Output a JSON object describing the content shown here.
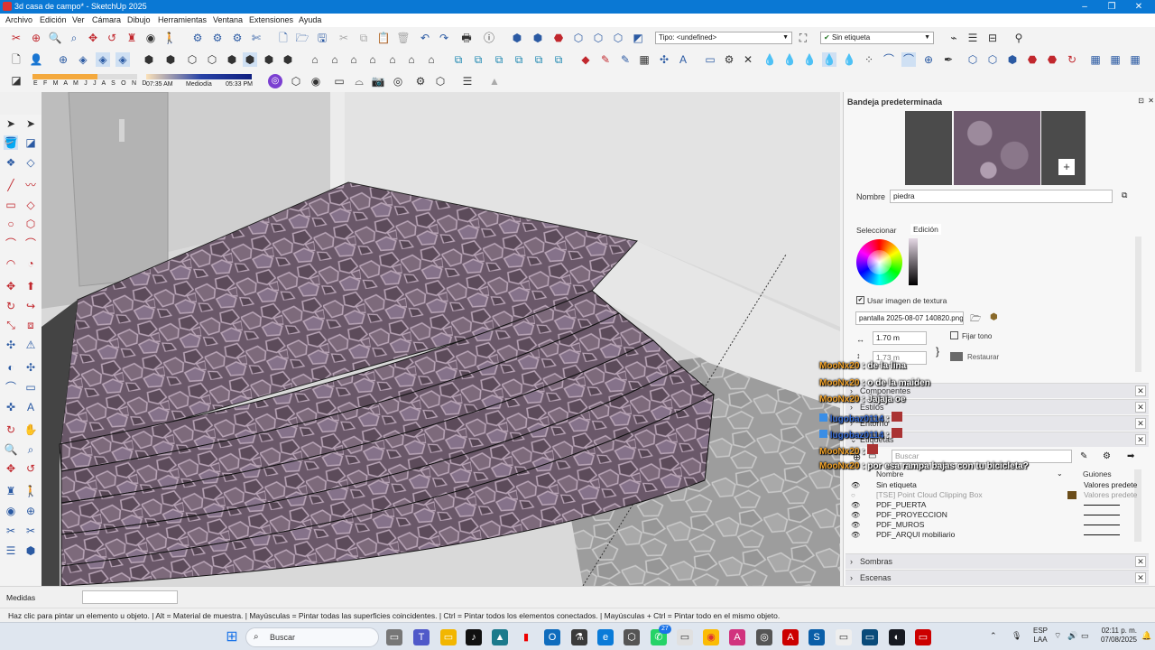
{
  "window": {
    "title": "3d casa de campo* - SketchUp 2025"
  },
  "menu": [
    "Archivo",
    "Edición",
    "Ver",
    "Cámara",
    "Dibujo",
    "Herramientas",
    "Ventana",
    "Extensiones",
    "Ayuda"
  ],
  "toolbar": {
    "type_select": "Tipo: <undefined>",
    "tag_select": "Sin etiqueta",
    "shadow_months": "E F M A M J J A S O N D",
    "time_start": "07:35 AM",
    "time_mid": "Mediodía",
    "time_end": "05:33 PM"
  },
  "panel": {
    "title": "Bandeja predeterminada",
    "name_label": "Nombre",
    "name_value": "piedra",
    "tab_select": "Seleccionar",
    "tab_edit": "Edición",
    "use_texture_label": "Usar imagen de textura",
    "texture_file": "pantalla 2025-08-07 140820.png",
    "width_value": "1.70 m",
    "height_value": "1.73 m",
    "fix_tone_label": "Fijar tono",
    "restore_label": "Restaurar",
    "sections": [
      "Componentes",
      "Estilos",
      "Entorno",
      "Etiquetas"
    ],
    "tags_search_placeholder": "Buscar",
    "tags_col_name": "Nombre",
    "tags_col_dashes": "Guiones",
    "tags": [
      {
        "name": "Sin etiqueta",
        "dash": "Valores predete",
        "dimmed": false,
        "line": false
      },
      {
        "name": "[TSE] Point Cloud Clipping Box",
        "dash": "Valores predete",
        "dimmed": true,
        "line": false
      },
      {
        "name": "PDF_PUERTA",
        "dash": "",
        "dimmed": false,
        "line": true
      },
      {
        "name": "PDF_PROYECCION",
        "dash": "",
        "dimmed": false,
        "line": true
      },
      {
        "name": "PDF_MUROS",
        "dash": "",
        "dimmed": false,
        "line": true
      },
      {
        "name": "PDF_ARQUI mobiliario",
        "dash": "",
        "dimmed": false,
        "line": true
      }
    ],
    "bottom_sections": [
      "Sombras",
      "Escenas"
    ]
  },
  "chat": [
    {
      "user": "MooNx20",
      "msg": ": de la lina"
    },
    {
      "user": "MooNx20",
      "msg": ": o de la maiden"
    },
    {
      "user": "MooNx20",
      "msg": ": Jajaja oe"
    },
    {
      "user": "lugobaz0114",
      "msg": ":"
    },
    {
      "user": "lugobaz0114",
      "msg": ":"
    },
    {
      "user": "MooNx20",
      "msg": ":"
    },
    {
      "user": "MooNx20",
      "msg": ": por esa rampa bajas con tu bicicleta?"
    }
  ],
  "status": {
    "measure_label": "Medidas",
    "hint": "Haz clic para pintar un elemento u objeto. | Alt = Material de muestra. | Mayúsculas = Pintar todas las superficies coincidentes. | Ctrl = Pintar todos los elementos conectados. | Mayúsculas + Ctrl = Pintar todo en el mismo objeto."
  },
  "taskbar": {
    "search_placeholder": "Buscar",
    "badge": "27",
    "lang": "ESP",
    "lang2": "LAA",
    "time": "02:11 p. m.",
    "date": "07/08/2025"
  },
  "colors": {
    "accent": "#0a78d4",
    "chat_user": "#f0a22a",
    "stone": "#6e5a6e"
  }
}
